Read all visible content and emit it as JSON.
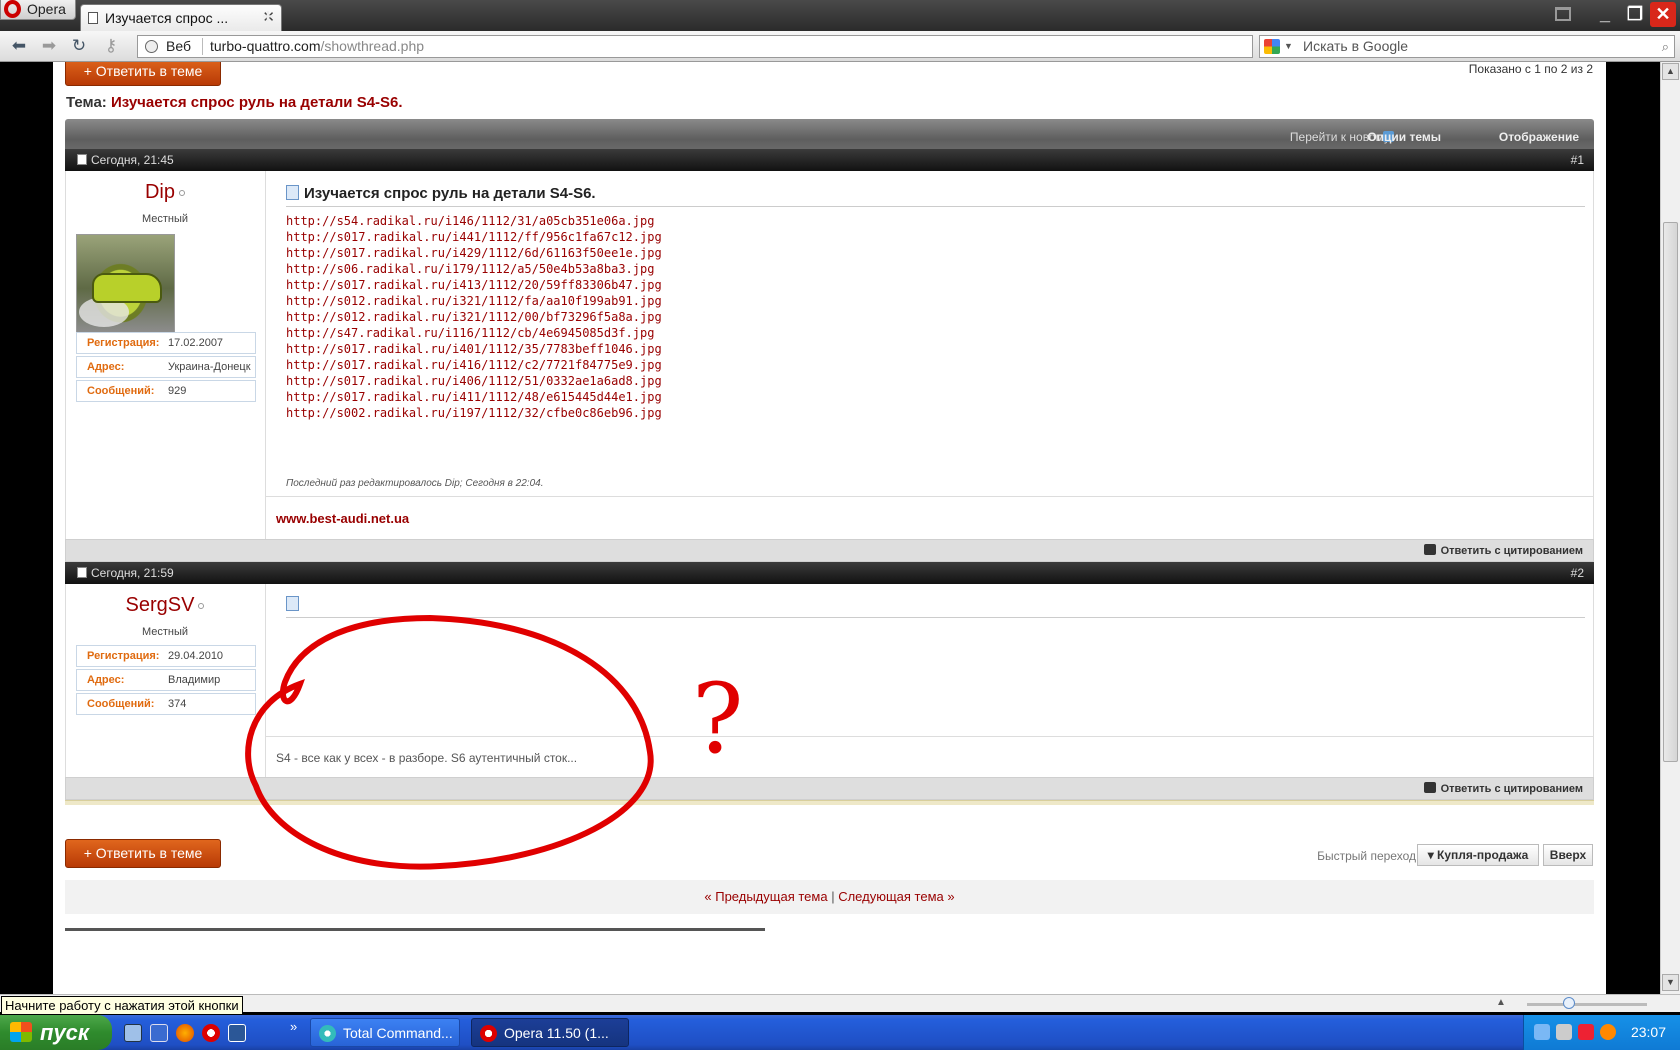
{
  "browser": {
    "menu_label": "Opera",
    "tab_title": "Изучается спрос ...",
    "address_prefix": "Веб",
    "url_host": "turbo-quattro.com",
    "url_path": "/showthread.php",
    "search_placeholder": "Искать в Google"
  },
  "thread": {
    "reply_button": "+ Ответить в теме",
    "pagination": "Показано с 1 по 2 из 2",
    "title_label": "Тема:",
    "title": "Изучается спрос руль на детали S4-S6.",
    "toolbar": {
      "goto_new": "Перейти к новому",
      "options": "Опции темы",
      "display": "Отображение"
    }
  },
  "posts": [
    {
      "date": "Сегодня, 21:45",
      "number": "#1",
      "username": "Dip",
      "usertitle": "Местный",
      "info": [
        {
          "key": "Регистрация:",
          "value": "17.02.2007"
        },
        {
          "key": "Адрес:",
          "value": "Украина-Донецк"
        },
        {
          "key": "Сообщений:",
          "value": "929"
        }
      ],
      "title": "Изучается спрос руль на детали S4-S6.",
      "links": [
        "http://s54.radikal.ru/i146/1112/31/a05cb351e06a.jpg",
        "http://s017.radikal.ru/i441/1112/ff/956c1fa67c12.jpg",
        "http://s017.radikal.ru/i429/1112/6d/61163f50ee1e.jpg",
        "http://s06.radikal.ru/i179/1112/a5/50e4b53a8ba3.jpg",
        "http://s017.radikal.ru/i413/1112/20/59ff83306b47.jpg",
        "http://s012.radikal.ru/i321/1112/fa/aa10f199ab91.jpg",
        "http://s012.radikal.ru/i321/1112/00/bf73296f5a8a.jpg",
        "http://s47.radikal.ru/i116/1112/cb/4e6945085d3f.jpg",
        "http://s017.radikal.ru/i401/1112/35/7783beff1046.jpg",
        "http://s017.radikal.ru/i416/1112/c2/7721f84775e9.jpg",
        "http://s017.radikal.ru/i406/1112/51/0332ae1a6ad8.jpg",
        "http://s017.radikal.ru/i411/1112/48/e615445d44e1.jpg",
        "http://s002.radikal.ru/i197/1112/32/cfbe0c86eb96.jpg"
      ],
      "edited_note": "Последний раз редактировалось Dip; Сегодня в 22:04.",
      "signature": "www.best-audi.net.ua",
      "quote_button": "Ответить с цитированием"
    },
    {
      "date": "Сегодня, 21:59",
      "number": "#2",
      "username": "SergSV",
      "usertitle": "Местный",
      "info": [
        {
          "key": "Регистрация:",
          "value": "29.04.2010"
        },
        {
          "key": "Адрес:",
          "value": "Владимир"
        },
        {
          "key": "Сообщений:",
          "value": "374"
        }
      ],
      "signature_text": "S4 - все как у всех - в разборе. S6 аутентичный сток...",
      "quote_button": "Ответить с цитированием"
    }
  ],
  "footer": {
    "reply_button": "+ Ответить в теме",
    "quick_nav_label": "Быстрый переход",
    "quick_nav_select": "Купля-продажа",
    "top_button": "Вверх",
    "prev_thread": "« Предыдущая тема",
    "separator": "|",
    "next_thread": "Следующая тема »"
  },
  "annotation": {
    "mark": "?",
    "color": "#e00000"
  },
  "os": {
    "tooltip": "Начните работу с нажатия этой кнопки",
    "start_label": "пуск",
    "tasks": [
      "Total Command...",
      "Opera 11.50 (1..."
    ],
    "clock": "23:07"
  }
}
